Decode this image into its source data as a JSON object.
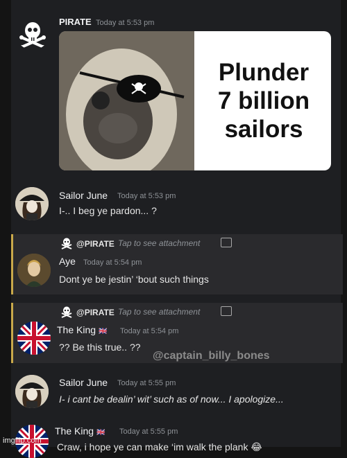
{
  "messages": [
    {
      "author": "PIRATE",
      "time": "Today at 5:53 pm"
    },
    {
      "author": "Sailor June",
      "time": "Today at 5:53 pm",
      "text": "I-.. I beg ye pardon... ?"
    },
    {
      "reply_to": "@PIRATE",
      "reply_hint": "Tap to see attachment",
      "author": "Aye",
      "time": "Today at 5:54 pm",
      "text": "Dont ye be jestin’ ‘bout such things"
    },
    {
      "reply_to": "@PIRATE",
      "reply_hint": "Tap to see attachment",
      "author": "The King",
      "author_flag": "🇬🇧",
      "time": "Today at 5:54 pm",
      "text": "?? Be this true.. ??"
    },
    {
      "author": "Sailor June",
      "time": "Today at 5:55 pm",
      "text": "I- i cant be dealin’ wit’ such as of now... I apologize..."
    },
    {
      "author": "The King",
      "author_flag": "🇬🇧",
      "time": "Today at 5:55 pm",
      "text": "Craw, i hope ye can make ‘im walk the plank 😂"
    }
  ],
  "attachment": {
    "caption_line1": "Plunder",
    "caption_line2": "7 billion",
    "caption_line3": "sailors"
  },
  "watermark": "@captain_billy_bones",
  "imgflip": "imgflip.com",
  "icons": {
    "pirate_avatar": "skull-crossbones-icon",
    "attachment": "image-icon"
  },
  "colors": {
    "background": "#1e1f22",
    "reply_bar": "#c9a94a",
    "timestamp": "#8e9297"
  }
}
